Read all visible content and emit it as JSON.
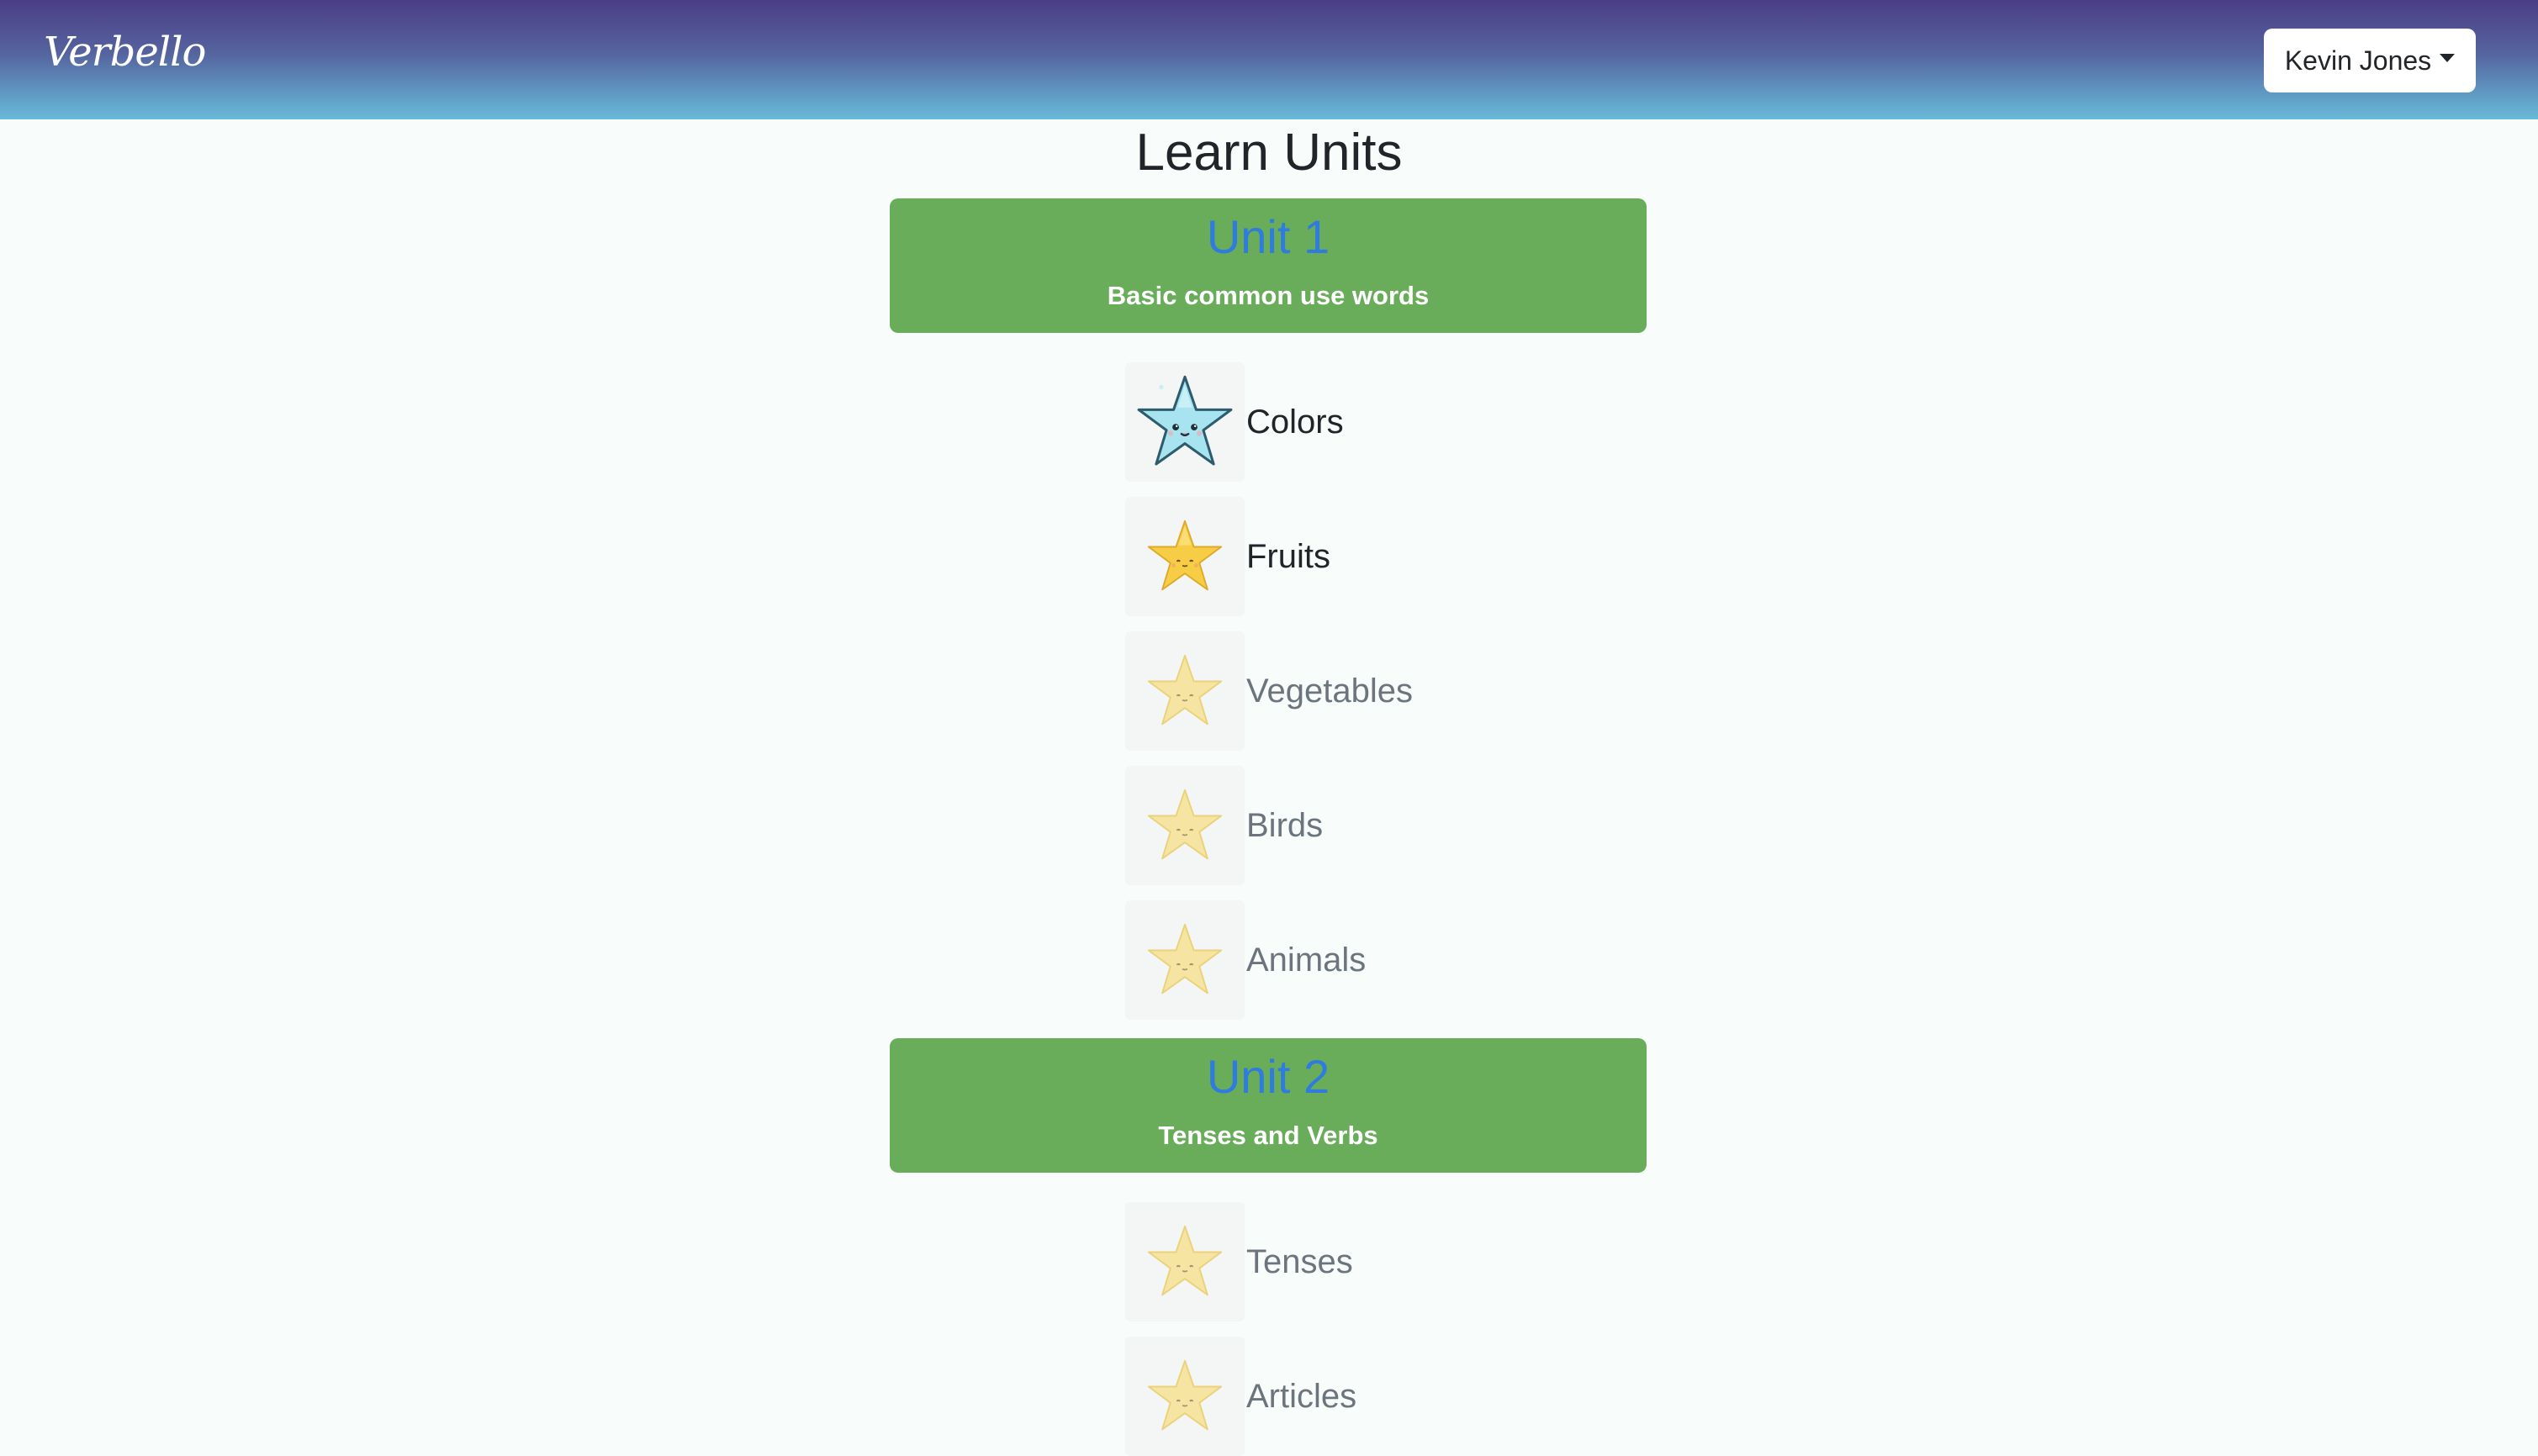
{
  "navbar": {
    "brand": "Verbello",
    "user_name": "Kevin Jones"
  },
  "page": {
    "title": "Learn Units"
  },
  "units": [
    {
      "title": "Unit 1",
      "description": "Basic common use words",
      "lessons": [
        {
          "label": "Colors",
          "status": "current",
          "icon": "blue-star-face-icon"
        },
        {
          "label": "Fruits",
          "status": "completed",
          "icon": "gold-star-face-icon"
        },
        {
          "label": "Vegetables",
          "status": "locked",
          "icon": "pale-star-face-icon"
        },
        {
          "label": "Birds",
          "status": "locked",
          "icon": "pale-star-face-icon"
        },
        {
          "label": "Animals",
          "status": "locked",
          "icon": "pale-star-face-icon"
        }
      ]
    },
    {
      "title": "Unit 2",
      "description": "Tenses and Verbs",
      "lessons": [
        {
          "label": "Tenses",
          "status": "locked",
          "icon": "pale-star-face-icon"
        },
        {
          "label": "Articles",
          "status": "locked",
          "icon": "pale-star-face-icon"
        }
      ]
    }
  ],
  "colors": {
    "unit_card_bg": "#69ad5b",
    "unit_title": "#2f7be0",
    "navbar_top": "#4b3d86",
    "navbar_bottom": "#68bad9",
    "current_star": "#9fe0ec",
    "completed_star": "#f7cd46",
    "locked_star": "#f5e4a4"
  }
}
